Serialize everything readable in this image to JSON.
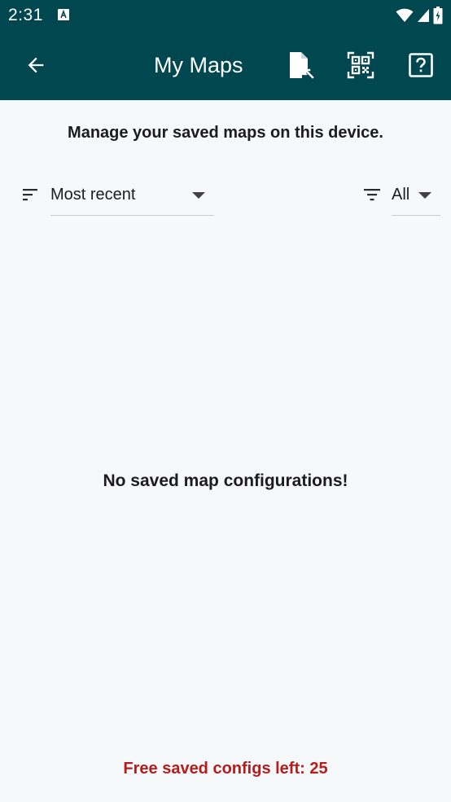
{
  "status_bar": {
    "time": "2:31",
    "notification_icon": "font-a-icon",
    "wifi_icon": "wifi-icon",
    "signal_icon": "cell-signal-icon",
    "battery_icon": "battery-charging-icon"
  },
  "app_bar": {
    "title": "My Maps",
    "back_icon": "arrow-left-icon",
    "import_icon": "file-import-icon",
    "qr_icon": "qr-code-scan-icon",
    "help_icon": "help-box-icon",
    "color": "#00474f"
  },
  "main": {
    "subtitle": "Manage your saved maps on this device.",
    "sort": {
      "icon": "sort-icon",
      "selected": "Most recent"
    },
    "filter": {
      "icon": "filter-icon",
      "selected": "All"
    },
    "empty_message": "No saved map configurations!",
    "quota_text": "Free saved configs left: 25",
    "quota_color": "#b71c1c"
  }
}
